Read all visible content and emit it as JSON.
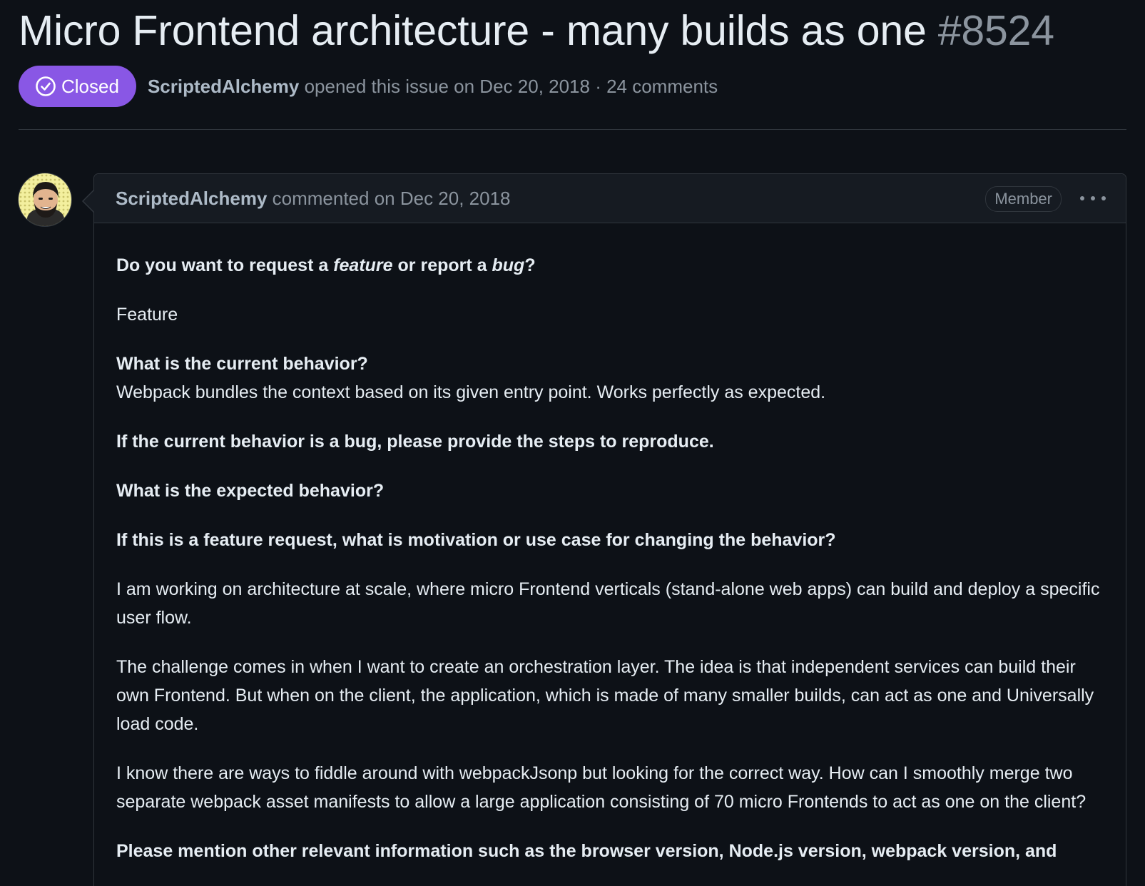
{
  "issue": {
    "title": "Micro Frontend architecture - many builds as one",
    "number": "#8524",
    "state": "Closed",
    "author": "ScriptedAlchemy",
    "opened_text": "opened this issue on Dec 20, 2018 · 24 comments"
  },
  "comment": {
    "author": "ScriptedAlchemy",
    "action_text": "commented on Dec 20, 2018",
    "role": "Member",
    "body": {
      "q1_prefix": "Do you want to request a ",
      "q1_feature": "feature",
      "q1_mid": " or report a ",
      "q1_bug": "bug",
      "q1_suffix": "?",
      "a1": "Feature",
      "q2": "What is the current behavior?",
      "a2": "Webpack bundles the context based on its given entry point. Works perfectly as expected.",
      "q3": "If the current behavior is a bug, please provide the steps to reproduce.",
      "q4": "What is the expected behavior?",
      "q5": "If this is a feature request, what is motivation or use case for changing the behavior?",
      "p1": "I am working on architecture at scale, where micro Frontend verticals (stand-alone web apps) can build and deploy a specific user flow.",
      "p2": "The challenge comes in when I want to create an orchestration layer. The idea is that independent services can build their own Frontend. But when on the client, the application, which is made of many smaller builds, can act as one and Universally load code.",
      "p3": "I know there are ways to fiddle around with webpackJsonp but looking for the correct way. How can I smoothly merge two separate webpack asset manifests to allow a large application consisting of 70 micro Frontends to act as one on the client?",
      "q6": "Please mention other relevant information such as the browser version, Node.js version, webpack version, and"
    }
  },
  "icons": {
    "state": "check-circle-icon",
    "menu": "kebab-horizontal-icon"
  },
  "colors": {
    "background": "#0d1117",
    "closed_badge": "#8957e5",
    "muted_text": "#8b949e",
    "border": "#30363d"
  }
}
